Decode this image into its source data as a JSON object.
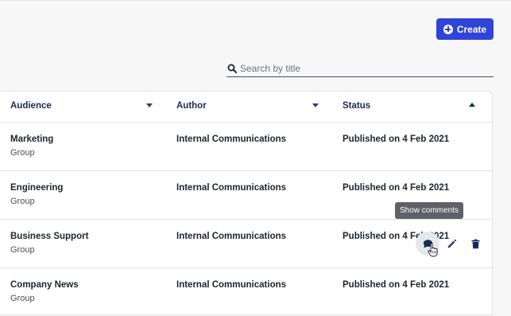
{
  "toolbar": {
    "create_label": "Create"
  },
  "search": {
    "placeholder": "Search by title",
    "value": ""
  },
  "table": {
    "columns": [
      {
        "label": "Audience",
        "sort": "none"
      },
      {
        "label": "Author",
        "sort": "none"
      },
      {
        "label": "Status",
        "sort": "ascending"
      }
    ],
    "rows": [
      {
        "audience": "Marketing",
        "audience_type": "Group",
        "author": "Internal Communications",
        "status": "Published on 4 Feb 2021"
      },
      {
        "audience": "Engineering",
        "audience_type": "Group",
        "author": "Internal Communications",
        "status": "Published on 4 Feb 2021"
      },
      {
        "audience": "Business Support",
        "audience_type": "Group",
        "author": "Internal Communications",
        "status": "Published on 4 Feb 2021"
      },
      {
        "audience": "Company News",
        "audience_type": "Group",
        "author": "Internal Communications",
        "status": "Published on 4 Feb 2021"
      }
    ]
  },
  "row_actions": {
    "comment_icon": "comment-icon",
    "edit_icon": "pencil-icon",
    "delete_icon": "trash-icon"
  },
  "tooltip": {
    "text": "Show comments"
  },
  "colors": {
    "primary": "#2f44d8",
    "heading": "#1a2a4f",
    "tooltip_bg": "#5f6166"
  }
}
